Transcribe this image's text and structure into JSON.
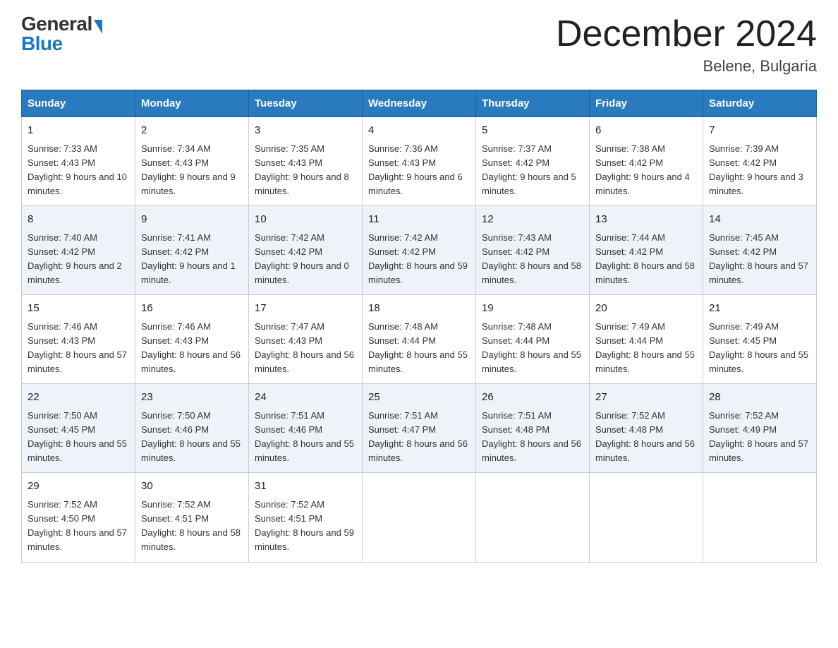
{
  "header": {
    "logo_general": "General",
    "logo_blue": "Blue",
    "month_title": "December 2024",
    "location": "Belene, Bulgaria"
  },
  "days_of_week": [
    "Sunday",
    "Monday",
    "Tuesday",
    "Wednesday",
    "Thursday",
    "Friday",
    "Saturday"
  ],
  "weeks": [
    [
      {
        "day": "1",
        "sunrise": "7:33 AM",
        "sunset": "4:43 PM",
        "daylight": "9 hours and 10 minutes."
      },
      {
        "day": "2",
        "sunrise": "7:34 AM",
        "sunset": "4:43 PM",
        "daylight": "9 hours and 9 minutes."
      },
      {
        "day": "3",
        "sunrise": "7:35 AM",
        "sunset": "4:43 PM",
        "daylight": "9 hours and 8 minutes."
      },
      {
        "day": "4",
        "sunrise": "7:36 AM",
        "sunset": "4:43 PM",
        "daylight": "9 hours and 6 minutes."
      },
      {
        "day": "5",
        "sunrise": "7:37 AM",
        "sunset": "4:42 PM",
        "daylight": "9 hours and 5 minutes."
      },
      {
        "day": "6",
        "sunrise": "7:38 AM",
        "sunset": "4:42 PM",
        "daylight": "9 hours and 4 minutes."
      },
      {
        "day": "7",
        "sunrise": "7:39 AM",
        "sunset": "4:42 PM",
        "daylight": "9 hours and 3 minutes."
      }
    ],
    [
      {
        "day": "8",
        "sunrise": "7:40 AM",
        "sunset": "4:42 PM",
        "daylight": "9 hours and 2 minutes."
      },
      {
        "day": "9",
        "sunrise": "7:41 AM",
        "sunset": "4:42 PM",
        "daylight": "9 hours and 1 minute."
      },
      {
        "day": "10",
        "sunrise": "7:42 AM",
        "sunset": "4:42 PM",
        "daylight": "9 hours and 0 minutes."
      },
      {
        "day": "11",
        "sunrise": "7:42 AM",
        "sunset": "4:42 PM",
        "daylight": "8 hours and 59 minutes."
      },
      {
        "day": "12",
        "sunrise": "7:43 AM",
        "sunset": "4:42 PM",
        "daylight": "8 hours and 58 minutes."
      },
      {
        "day": "13",
        "sunrise": "7:44 AM",
        "sunset": "4:42 PM",
        "daylight": "8 hours and 58 minutes."
      },
      {
        "day": "14",
        "sunrise": "7:45 AM",
        "sunset": "4:42 PM",
        "daylight": "8 hours and 57 minutes."
      }
    ],
    [
      {
        "day": "15",
        "sunrise": "7:46 AM",
        "sunset": "4:43 PM",
        "daylight": "8 hours and 57 minutes."
      },
      {
        "day": "16",
        "sunrise": "7:46 AM",
        "sunset": "4:43 PM",
        "daylight": "8 hours and 56 minutes."
      },
      {
        "day": "17",
        "sunrise": "7:47 AM",
        "sunset": "4:43 PM",
        "daylight": "8 hours and 56 minutes."
      },
      {
        "day": "18",
        "sunrise": "7:48 AM",
        "sunset": "4:44 PM",
        "daylight": "8 hours and 55 minutes."
      },
      {
        "day": "19",
        "sunrise": "7:48 AM",
        "sunset": "4:44 PM",
        "daylight": "8 hours and 55 minutes."
      },
      {
        "day": "20",
        "sunrise": "7:49 AM",
        "sunset": "4:44 PM",
        "daylight": "8 hours and 55 minutes."
      },
      {
        "day": "21",
        "sunrise": "7:49 AM",
        "sunset": "4:45 PM",
        "daylight": "8 hours and 55 minutes."
      }
    ],
    [
      {
        "day": "22",
        "sunrise": "7:50 AM",
        "sunset": "4:45 PM",
        "daylight": "8 hours and 55 minutes."
      },
      {
        "day": "23",
        "sunrise": "7:50 AM",
        "sunset": "4:46 PM",
        "daylight": "8 hours and 55 minutes."
      },
      {
        "day": "24",
        "sunrise": "7:51 AM",
        "sunset": "4:46 PM",
        "daylight": "8 hours and 55 minutes."
      },
      {
        "day": "25",
        "sunrise": "7:51 AM",
        "sunset": "4:47 PM",
        "daylight": "8 hours and 56 minutes."
      },
      {
        "day": "26",
        "sunrise": "7:51 AM",
        "sunset": "4:48 PM",
        "daylight": "8 hours and 56 minutes."
      },
      {
        "day": "27",
        "sunrise": "7:52 AM",
        "sunset": "4:48 PM",
        "daylight": "8 hours and 56 minutes."
      },
      {
        "day": "28",
        "sunrise": "7:52 AM",
        "sunset": "4:49 PM",
        "daylight": "8 hours and 57 minutes."
      }
    ],
    [
      {
        "day": "29",
        "sunrise": "7:52 AM",
        "sunset": "4:50 PM",
        "daylight": "8 hours and 57 minutes."
      },
      {
        "day": "30",
        "sunrise": "7:52 AM",
        "sunset": "4:51 PM",
        "daylight": "8 hours and 58 minutes."
      },
      {
        "day": "31",
        "sunrise": "7:52 AM",
        "sunset": "4:51 PM",
        "daylight": "8 hours and 59 minutes."
      },
      null,
      null,
      null,
      null
    ]
  ],
  "labels": {
    "sunrise": "Sunrise:",
    "sunset": "Sunset:",
    "daylight": "Daylight:"
  }
}
